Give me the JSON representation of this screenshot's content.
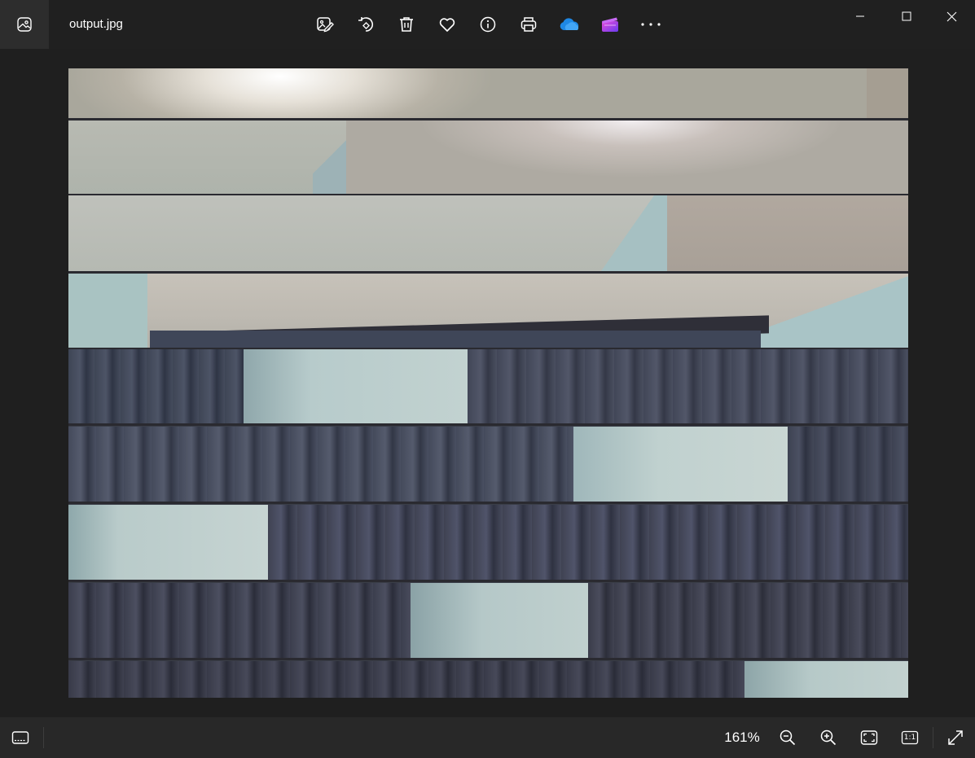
{
  "window": {
    "filename": "output.jpg"
  },
  "toolbar": {
    "items": [
      {
        "name": "edit-image-icon"
      },
      {
        "name": "rotate-icon"
      },
      {
        "name": "delete-icon"
      },
      {
        "name": "favorite-heart-icon"
      },
      {
        "name": "file-info-icon"
      },
      {
        "name": "print-icon"
      },
      {
        "name": "onedrive-cloud-icon"
      },
      {
        "name": "clipchamp-icon"
      },
      {
        "name": "more-options-icon"
      }
    ]
  },
  "window_controls": [
    "minimize-icon",
    "maximize-icon",
    "close-icon"
  ],
  "statusbar": {
    "zoom_level": "161%",
    "actual_size_label": "1:1"
  },
  "colors": {
    "onedrive_blue": "#1e88e5",
    "clipchamp_purple": "#8e44e8",
    "curtain": "#3d4352",
    "wall_light": "#b9ccd0",
    "ceiling": "#c9c3b8"
  }
}
